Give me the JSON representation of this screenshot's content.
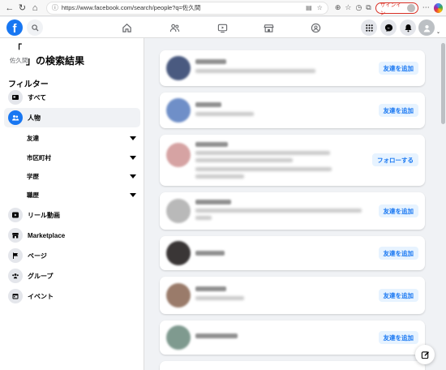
{
  "browser": {
    "url": "https://www.facebook.com/search/people?q=佐久間",
    "signin_label": "サインイン"
  },
  "header": {
    "logo_letter": "f",
    "nav_icons": [
      "home-icon",
      "friends-icon",
      "video-icon",
      "marketplace-icon",
      "groups-icon"
    ],
    "right_icons": [
      "menu-grid-icon",
      "messenger-icon",
      "notifications-icon",
      "profile-avatar"
    ]
  },
  "sidebar": {
    "title_open": "「",
    "query": "佐久間",
    "title_rest": "」の検索結果",
    "filter_heading": "フィルター",
    "items": [
      {
        "label": "すべて",
        "icon": "all-results-icon"
      },
      {
        "label": "人物",
        "icon": "people-icon",
        "active": true
      },
      {
        "label": "リール動画",
        "icon": "reels-icon"
      },
      {
        "label": "Marketplace",
        "icon": "marketplace-icon"
      },
      {
        "label": "ページ",
        "icon": "flag-icon"
      },
      {
        "label": "グループ",
        "icon": "groups-icon"
      },
      {
        "label": "イベント",
        "icon": "calendar-icon"
      }
    ],
    "subfilters": [
      "友達",
      "市区町村",
      "学歴",
      "職歴"
    ]
  },
  "results": {
    "add_friend_label": "友達を追加",
    "follow_label": "フォローする",
    "people": [
      {
        "button": "友達を追加",
        "avatar_color": "#4a5a80"
      },
      {
        "button": "友達を追加",
        "avatar_color": "#6f8fc8"
      },
      {
        "button": "フォローする",
        "avatar_color": "#d6a3a3"
      },
      {
        "button": "友達を追加",
        "avatar_color": "#b9b9b9"
      },
      {
        "button": "友達を追加",
        "avatar_color": "#3a3636"
      },
      {
        "button": "友達を追加",
        "avatar_color": "#9a7b6a"
      },
      {
        "button": "友達を追加",
        "avatar_color": "#7f9a8f"
      }
    ]
  },
  "colors": {
    "brand": "#1877f2",
    "button_bg": "#e7f3ff",
    "page_bg": "#f0f2f5"
  }
}
